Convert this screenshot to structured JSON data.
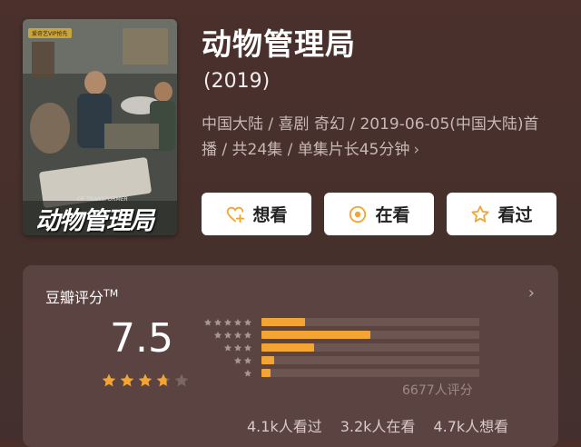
{
  "poster": {
    "vip_badge": "爱奇艺VIP抢先",
    "title_art": "动物管理局",
    "subtitle_art": "OF TRANSFORMER"
  },
  "movie": {
    "title": "动物管理局",
    "year": "(2019)",
    "meta_line": "中国大陆 / 喜剧 奇幻 / 2019-06-05(中国大陆)首播 / 共24集 / 单集片长45分钟",
    "meta_chevron": "›"
  },
  "actions": [
    {
      "label": "想看",
      "icon": "heart-plus-icon"
    },
    {
      "label": "在看",
      "icon": "target-circle-icon"
    },
    {
      "label": "看过",
      "icon": "star-outline-icon"
    }
  ],
  "rating": {
    "label": "豆瓣评分",
    "trademark": "TM",
    "score": "7.5",
    "stars": 3.75,
    "rating_count": "6677人评分",
    "distribution": [
      {
        "stars": 5,
        "fraction": 0.2
      },
      {
        "stars": 4,
        "fraction": 0.5
      },
      {
        "stars": 3,
        "fraction": 0.24
      },
      {
        "stars": 2,
        "fraction": 0.06
      },
      {
        "stars": 1,
        "fraction": 0.04
      }
    ],
    "footer": {
      "watched": "4.1k人看过",
      "watching": "3.2k人在看",
      "want": "4.7k人想看"
    }
  },
  "colors": {
    "accent": "#f3a533",
    "background": "#4a2f2b",
    "card": "#5a4340"
  }
}
